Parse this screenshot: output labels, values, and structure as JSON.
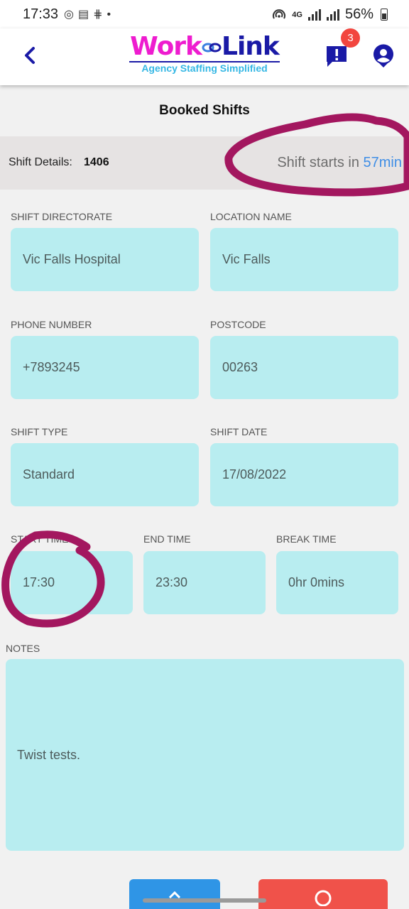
{
  "status_bar": {
    "time": "17:33",
    "network": "4G",
    "battery": "56%",
    "left_icons": [
      "whatsapp-icon",
      "message-icon",
      "slack-icon",
      "dot-icon"
    ]
  },
  "app_bar": {
    "logo_word_1": "Work",
    "logo_word_2": "Link",
    "logo_tagline": "Agency Staffing Simplified",
    "notification_count": "3",
    "colors": {
      "brand_pink": "#ee1ccf",
      "brand_navy": "#1a1aa6",
      "brand_cyan": "#35b7e4",
      "badge_red": "#f2463f"
    }
  },
  "page": {
    "title": "Booked Shifts"
  },
  "shift_details": {
    "label": "Shift Details:",
    "id": "1406",
    "starts_prefix": "Shift starts in",
    "starts_value": "57min"
  },
  "fields": {
    "directorate": {
      "label": "SHIFT DIRECTORATE",
      "value": "Vic Falls Hospital"
    },
    "location": {
      "label": "LOCATION NAME",
      "value": "Vic Falls"
    },
    "phone": {
      "label": "PHONE NUMBER",
      "value": "+7893245"
    },
    "postcode": {
      "label": "POSTCODE",
      "value": "00263"
    },
    "shift_type": {
      "label": "SHIFT TYPE",
      "value": "Standard"
    },
    "shift_date": {
      "label": "SHIFT DATE",
      "value": "17/08/2022"
    },
    "start_time": {
      "label": "START TIME",
      "value": "17:30"
    },
    "end_time": {
      "label": "END TIME",
      "value": "23:30"
    },
    "break_time": {
      "label": "BREAK TIME",
      "value": "0hr 0mins"
    },
    "notes": {
      "label": "NOTES",
      "value": "Twist tests."
    }
  },
  "colors": {
    "field_bg": "#b8edf0",
    "accent_blue": "#3f8ee6",
    "annotation": "#a3175f",
    "button_blue": "#2f95e6",
    "button_red": "#f0524a"
  }
}
